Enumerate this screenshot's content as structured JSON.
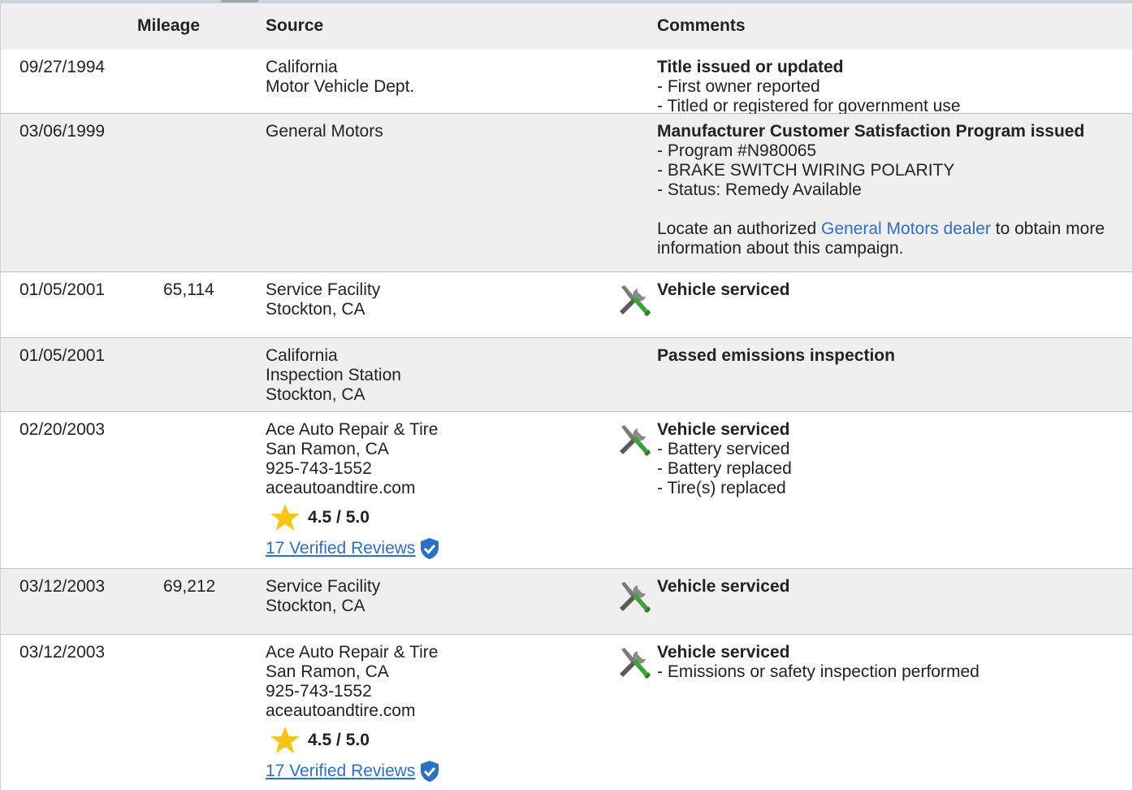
{
  "header": {
    "mileage": "Mileage",
    "source": "Source",
    "comments": "Comments"
  },
  "rows": [
    {
      "date": "09/27/1994",
      "mileage": "",
      "source": [
        "California",
        "Motor Vehicle Dept."
      ],
      "comment_title": "Title issued or updated",
      "comment_lines": [
        "- First owner reported",
        "- Titled or registered for government use"
      ],
      "icon": ""
    },
    {
      "date": "03/06/1999",
      "mileage": "",
      "source": [
        "General Motors"
      ],
      "comment_title": "Manufacturer Customer Satisfaction Program issued",
      "comment_lines": [
        "- Program #N980065",
        "- BRAKE SWITCH WIRING POLARITY",
        "- Status: Remedy Available"
      ],
      "note_before": "Locate an authorized ",
      "note_link": "General Motors dealer",
      "note_after": " to obtain more information about this campaign.",
      "icon": ""
    },
    {
      "date": "01/05/2001",
      "mileage": "65,114",
      "source": [
        "Service Facility",
        "Stockton, CA"
      ],
      "comment_title": "Vehicle serviced",
      "comment_lines": [],
      "icon": "wrench-screwdriver-icon"
    },
    {
      "date": "01/05/2001",
      "mileage": "",
      "source": [
        "California",
        "Inspection Station",
        "Stockton, CA"
      ],
      "comment_title": "Passed emissions inspection",
      "comment_lines": [],
      "icon": ""
    },
    {
      "date": "02/20/2003",
      "mileage": "",
      "source": [
        "Ace Auto Repair & Tire",
        "San Ramon, CA",
        "925-743-1552",
        "aceautoandtire.com"
      ],
      "rating": "4.5 / 5.0",
      "reviews": "17 Verified Reviews",
      "comment_title": "Vehicle serviced",
      "comment_lines": [
        "- Battery serviced",
        "- Battery replaced",
        "- Tire(s) replaced"
      ],
      "icon": "wrench-screwdriver-icon"
    },
    {
      "date": "03/12/2003",
      "mileage": "69,212",
      "source": [
        "Service Facility",
        "Stockton, CA"
      ],
      "comment_title": "Vehicle serviced",
      "comment_lines": [],
      "icon": "wrench-screwdriver-icon"
    },
    {
      "date": "03/12/2003",
      "mileage": "",
      "source": [
        "Ace Auto Repair & Tire",
        "San Ramon, CA",
        "925-743-1552",
        "aceautoandtire.com"
      ],
      "rating": "4.5 / 5.0",
      "reviews": "17 Verified Reviews",
      "comment_title": "Vehicle serviced",
      "comment_lines": [
        "- Emissions or safety inspection performed"
      ],
      "icon": "wrench-screwdriver-icon"
    }
  ],
  "colors": {
    "link": "#2f6fbf",
    "star": "#f5c518",
    "shield": "#2f6fbf",
    "row_alt": "#efefef"
  }
}
